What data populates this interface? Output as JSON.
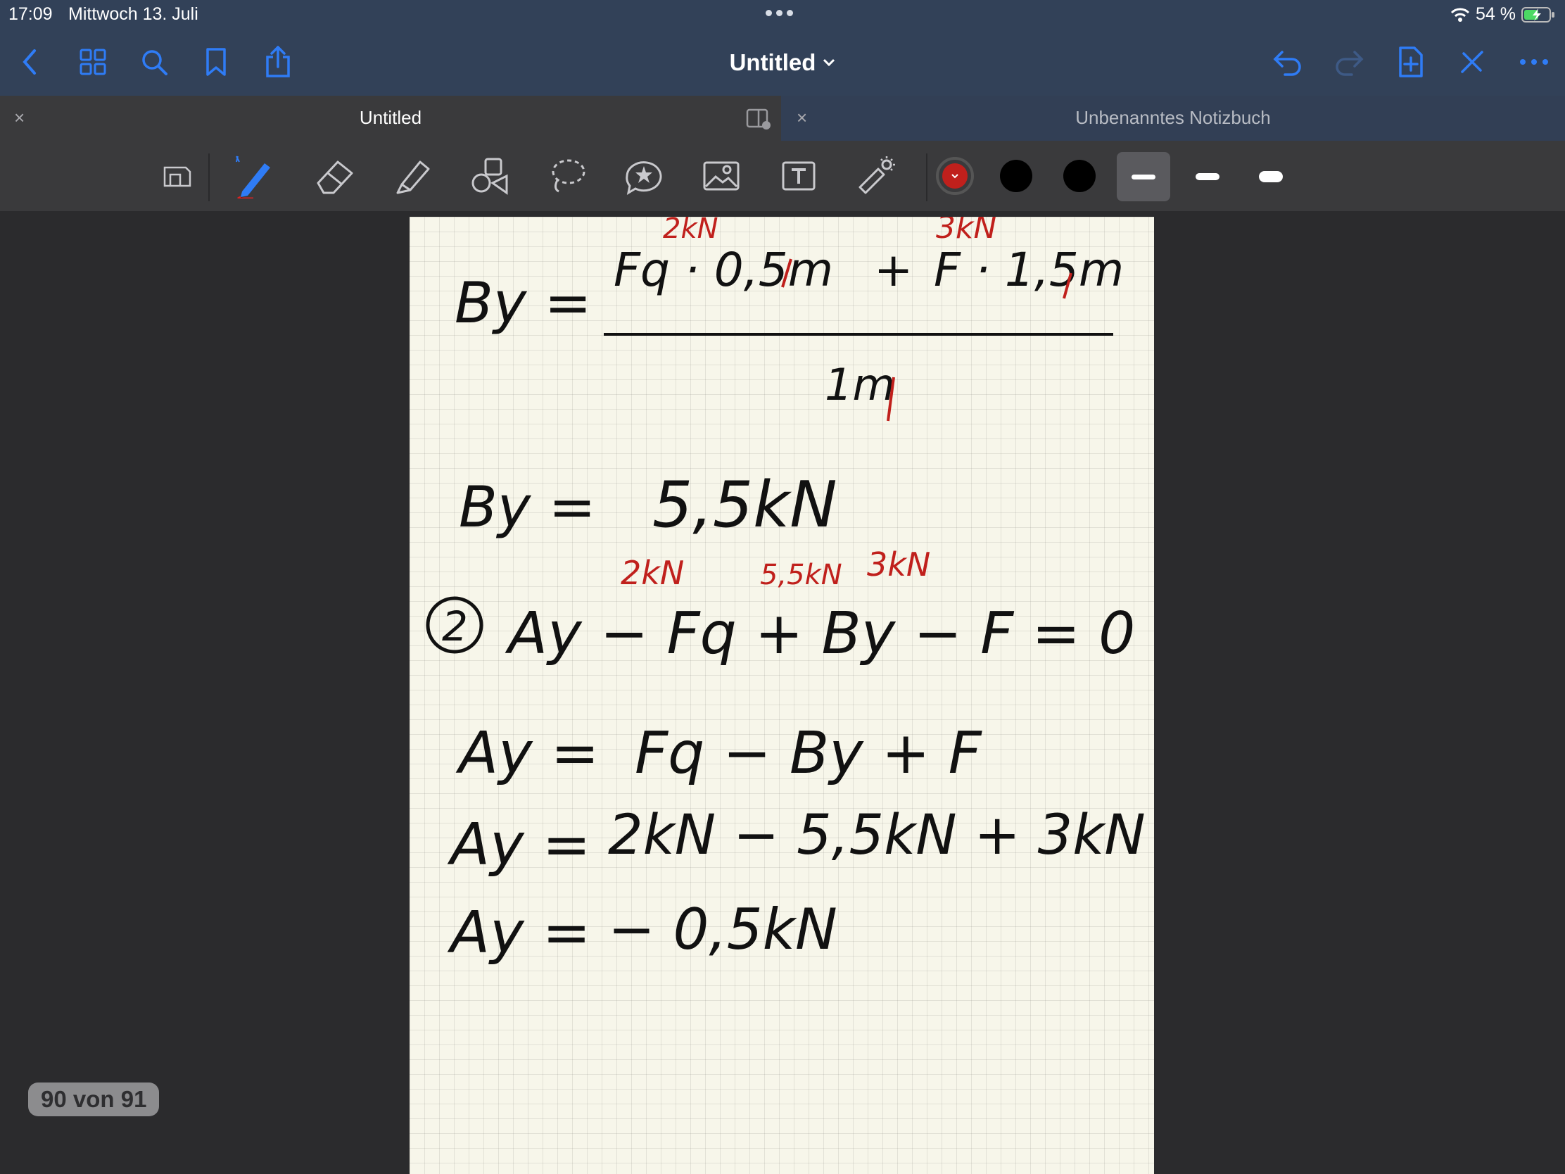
{
  "status": {
    "time": "17:09",
    "date": "Mittwoch 13. Juli",
    "battery": "54 %"
  },
  "nav": {
    "title": "Untitled"
  },
  "tabs": [
    {
      "label": "Untitled",
      "close": "×"
    },
    {
      "label": "Unbenanntes Notizbuch",
      "close": "×"
    }
  ],
  "colors": {
    "accent": "#2f7cf6",
    "ink_red": "#c0201c",
    "ink_black": "#111111",
    "nav_bg": "#324158",
    "page_bg": "#f7f6ea"
  },
  "toolbar": {
    "tools": [
      "zoom-window-icon",
      "pen-icon",
      "eraser-icon",
      "highlighter-icon",
      "shapes-icon",
      "lasso-icon",
      "stickers-icon",
      "image-icon",
      "text-icon",
      "laser-pointer-icon"
    ],
    "swatches": [
      "#c0201c",
      "#000000",
      "#000000"
    ]
  },
  "note": {
    "line1_lhs": "By =",
    "line1_num_a": "Fq · 0,5m",
    "line1_plus": "+",
    "line1_num_b": "F · 1,5m",
    "line1_ann_a": "2kN",
    "line1_ann_b": "3kN",
    "line1_den": "1m",
    "line2": "By =",
    "line2_val": "5,5kN",
    "ann2_a": "2kN",
    "ann2_b": "5,5kN",
    "ann2_c": "3kN",
    "eq2_num": "2",
    "eq2": "Ay − Fq + By − F = 0",
    "l4_lhs": "Ay =",
    "l4_rhs": "Fq − By + F",
    "l5_lhs": "Ay =",
    "l5_rhs": "2kN − 5,5kN + 3kN",
    "l6_lhs": "Ay =",
    "l6_rhs": "− 0,5kN"
  },
  "page_indicator": "90 von 91"
}
